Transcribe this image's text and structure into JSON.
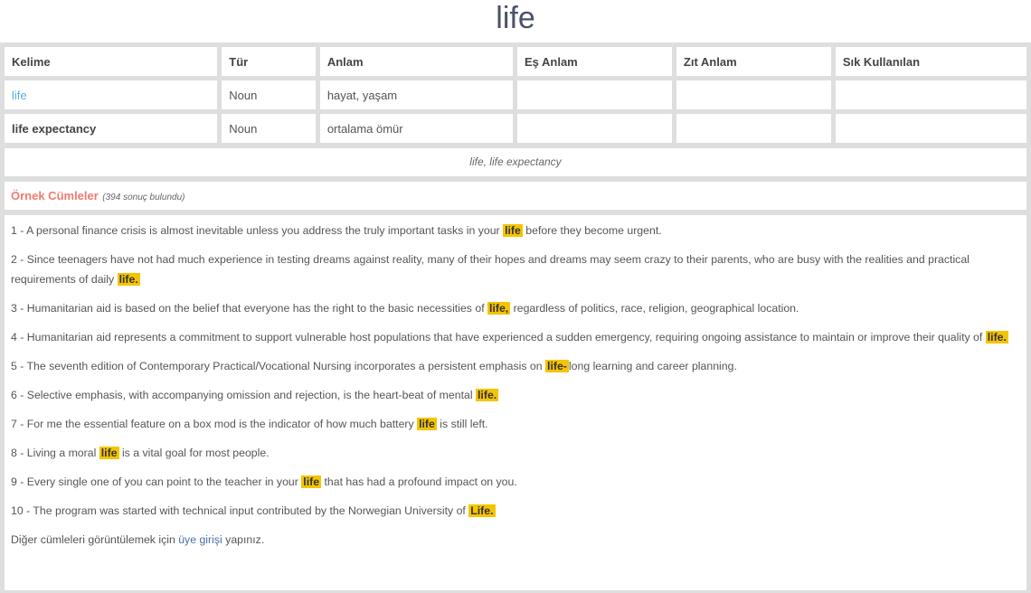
{
  "page_title": "life",
  "table": {
    "headers": [
      "Kelime",
      "Tür",
      "Anlam",
      "Eş Anlam",
      "Zıt Anlam",
      "Sık Kullanılan"
    ],
    "rows": [
      {
        "word": "life",
        "type": "Noun",
        "meaning": "hayat, yaşam",
        "synonym": "",
        "antonym": "",
        "frequent": ""
      },
      {
        "word": "life expectancy",
        "type": "Noun",
        "meaning": "ortalama ömür",
        "synonym": "",
        "antonym": "",
        "frequent": ""
      }
    ]
  },
  "related_words": "life, life expectancy",
  "examples": {
    "label": "Örnek Cümleler",
    "count_text": "(394 sonuç bulundu)",
    "highlight_color": "#f5c400",
    "sentences": [
      {
        "pre": "1 - A personal finance crisis is almost inevitable unless you address the truly important tasks in your",
        "hl": "life",
        "post": "before they become urgent."
      },
      {
        "pre": "2 - Since teenagers have not had much experience in testing dreams against reality, many of their hopes and dreams may seem crazy to their parents, who are busy with the realities and practical requirements of daily",
        "hl": "life.",
        "post": ""
      },
      {
        "pre": "3 - Humanitarian aid is based on the belief that everyone has the right to the basic necessities of",
        "hl": "life,",
        "post": "regardless of politics, race, religion, geographical location."
      },
      {
        "pre": "4 - Humanitarian aid represents a commitment to support vulnerable host populations that have experienced a sudden emergency, requiring ongoing assistance to maintain or improve their quality of",
        "hl": "life.",
        "post": ""
      },
      {
        "pre": "5 - The seventh edition of Contemporary Practical/Vocational Nursing incorporates a persistent emphasis on",
        "hl": "life-",
        "post": "long learning and career planning."
      },
      {
        "pre": "6 - Selective emphasis, with accompanying omission and rejection, is the heart-beat of mental",
        "hl": "life.",
        "post": ""
      },
      {
        "pre": "7 - For me the essential feature on a box mod is the indicator of how much battery",
        "hl": "life",
        "post": "is still left."
      },
      {
        "pre": "8 - Living a moral",
        "hl": "life",
        "post": "is a vital goal for most people."
      },
      {
        "pre": "9 - Every single one of you can point to the teacher in your",
        "hl": "life",
        "post": "that has had a profound impact on you."
      },
      {
        "pre": "10 - The program was started with technical input contributed by the Norwegian University of",
        "hl": "Life.",
        "post": ""
      }
    ],
    "login_note": {
      "pre": "Diğer cümleleri görüntülemek için",
      "link": "üye girişi",
      "post": "yapınız."
    }
  }
}
